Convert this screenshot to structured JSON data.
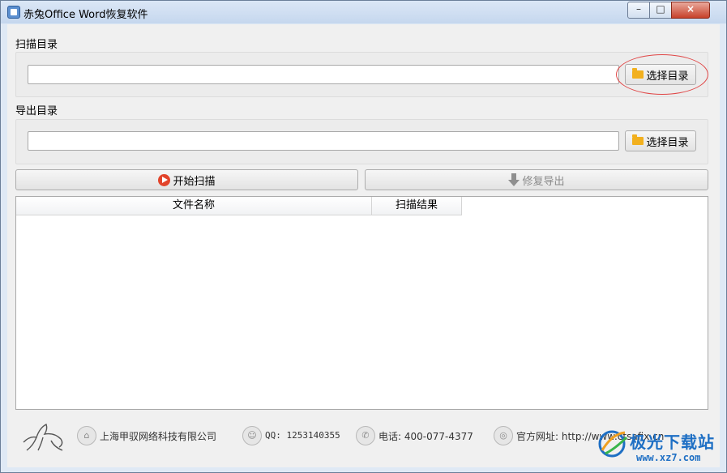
{
  "window": {
    "title": "赤兔Office Word恢复软件",
    "minimize": "–",
    "maximize": "□",
    "close": "×"
  },
  "scan_dir": {
    "label": "扫描目录",
    "value": "",
    "button": "选择目录"
  },
  "export_dir": {
    "label": "导出目录",
    "value": "",
    "button": "选择目录"
  },
  "actions": {
    "start_scan": "开始扫描",
    "repair_export": "修复导出"
  },
  "table": {
    "columns": [
      "文件名称",
      "扫描结果"
    ],
    "rows": []
  },
  "footer": {
    "company": "上海甲驭网络科技有限公司",
    "qq": "QQ: 1253140355",
    "phone": "电话: 400-077-4377",
    "website": "官方网址: http://www.ctsafix.cn"
  },
  "watermark": {
    "title": "极光下载站",
    "url": "www.xz7.com"
  },
  "colors": {
    "accent_red": "#e2442b",
    "folder": "#f2b01e",
    "watermark_blue": "#1e6fc4"
  }
}
